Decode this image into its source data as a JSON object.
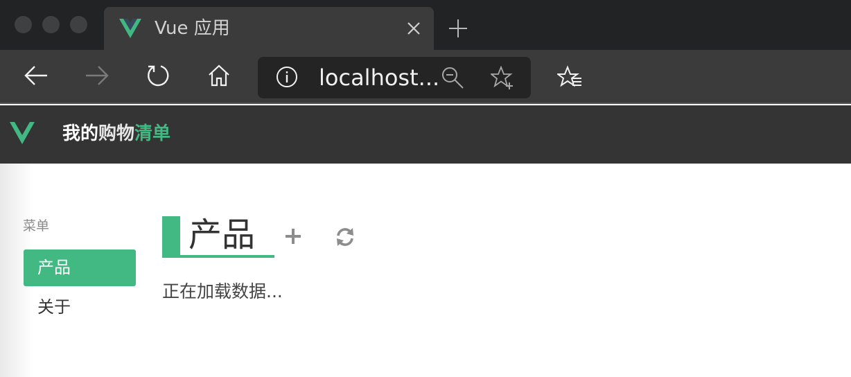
{
  "browser": {
    "tab": {
      "title": "Vue 应用",
      "icon": "vue-logo"
    },
    "address": {
      "url": "localhost..."
    },
    "icons": {
      "back": "arrow-left-icon",
      "forward": "arrow-right-icon",
      "reload": "reload-icon",
      "home": "home-icon",
      "info": "info-icon",
      "zoom": "zoom-out-icon",
      "favorite": "add-favorite-icon",
      "favorites_list": "favorites-list-icon",
      "close_tab": "close-icon",
      "new_tab": "plus-icon"
    }
  },
  "app": {
    "title_parts": {
      "white": "我的",
      "light": "购物",
      "accent": "清单"
    },
    "colors": {
      "accent": "#42b883",
      "header_bg": "#343434"
    }
  },
  "sidebar": {
    "label": "菜单",
    "items": [
      {
        "label": "产品",
        "active": true
      },
      {
        "label": "关于",
        "active": false
      }
    ]
  },
  "main": {
    "heading": "产品",
    "status": "正在加载数据..."
  }
}
